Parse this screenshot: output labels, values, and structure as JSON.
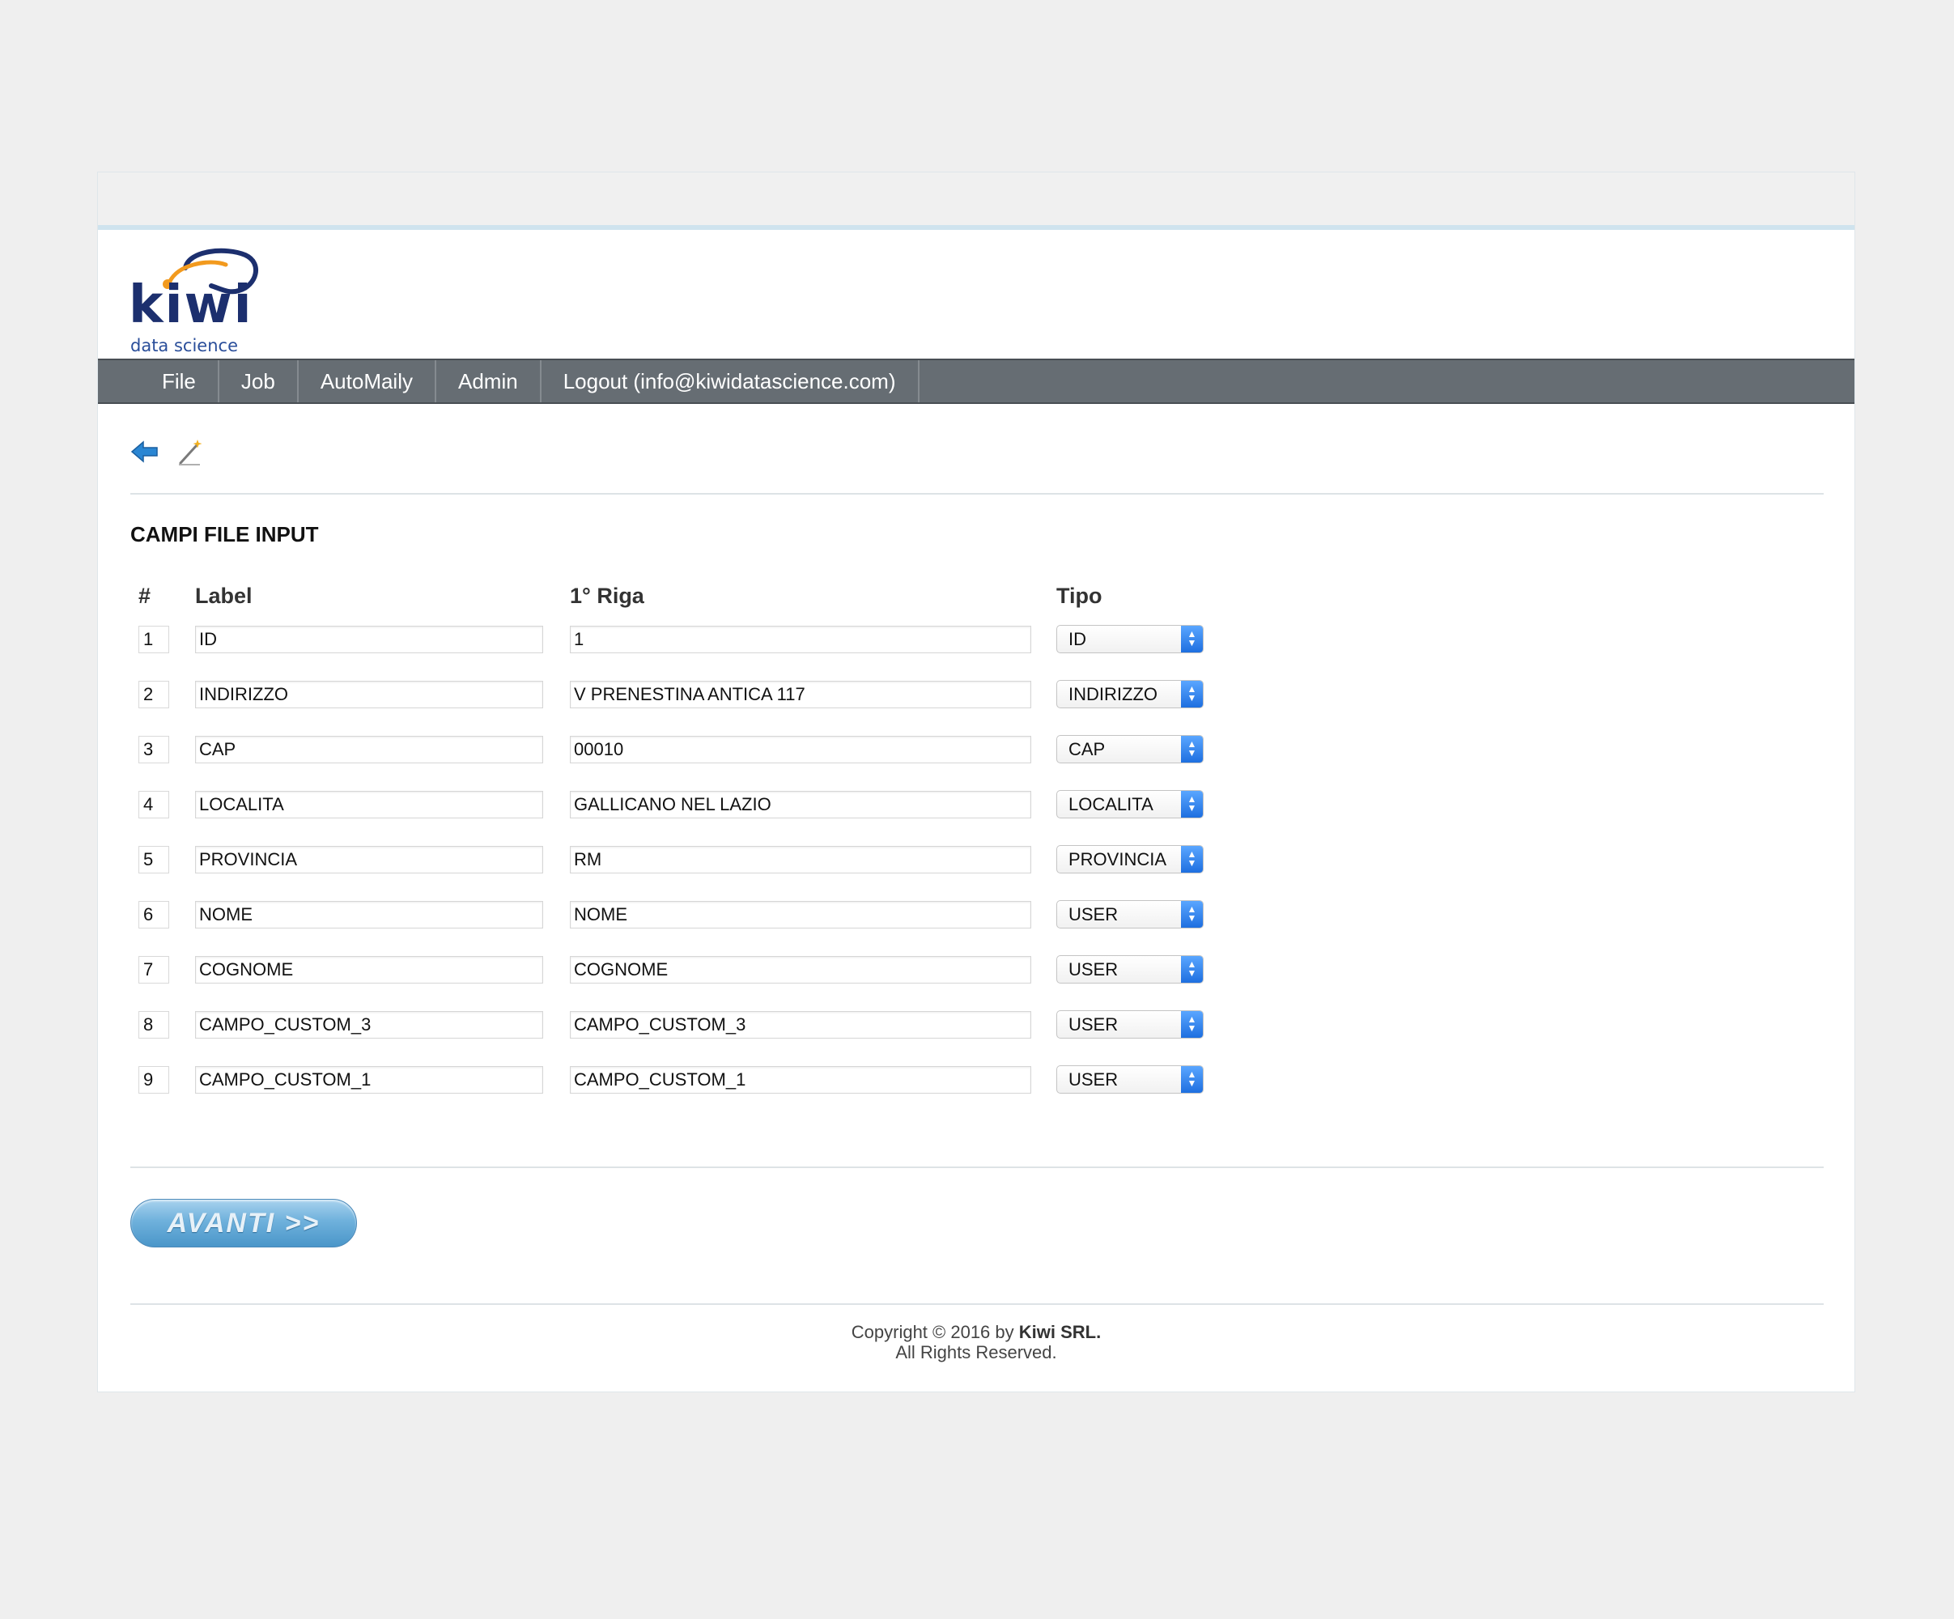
{
  "brand": {
    "logo_word": "kiwi",
    "logo_sub": "data science",
    "colors": {
      "navy": "#1c2f6e",
      "orange": "#f29a1e",
      "nav_bg": "#666d73",
      "select_accent": "#2f7ff0",
      "button_blue": "#6fb1dc"
    }
  },
  "nav": {
    "items": [
      {
        "label": "File"
      },
      {
        "label": "Job"
      },
      {
        "label": "AutoMaily"
      },
      {
        "label": "Admin"
      },
      {
        "label": "Logout (info@kiwidatascience.com)"
      }
    ]
  },
  "toolbar": {
    "icons": [
      "back-arrow-icon",
      "magic-wand-icon"
    ]
  },
  "section": {
    "title": "CAMPI FILE INPUT"
  },
  "table": {
    "headers": {
      "num": "#",
      "label": "Label",
      "riga": "1° Riga",
      "tipo": "Tipo"
    },
    "rows": [
      {
        "num": "1",
        "label": "ID",
        "riga": "1",
        "tipo": "ID"
      },
      {
        "num": "2",
        "label": "INDIRIZZO",
        "riga": "V PRENESTINA ANTICA 117",
        "tipo": "INDIRIZZO"
      },
      {
        "num": "3",
        "label": "CAP",
        "riga": "00010",
        "tipo": "CAP"
      },
      {
        "num": "4",
        "label": "LOCALITA",
        "riga": "GALLICANO NEL LAZIO",
        "tipo": "LOCALITA"
      },
      {
        "num": "5",
        "label": "PROVINCIA",
        "riga": "RM",
        "tipo": "PROVINCIA"
      },
      {
        "num": "6",
        "label": "NOME",
        "riga": "NOME",
        "tipo": "USER"
      },
      {
        "num": "7",
        "label": "COGNOME",
        "riga": "COGNOME",
        "tipo": "USER"
      },
      {
        "num": "8",
        "label": "CAMPO_CUSTOM_3",
        "riga": "CAMPO_CUSTOM_3",
        "tipo": "USER"
      },
      {
        "num": "9",
        "label": "CAMPO_CUSTOM_1",
        "riga": "CAMPO_CUSTOM_1",
        "tipo": "USER"
      }
    ]
  },
  "actions": {
    "next_label": "AVANTI >>"
  },
  "footer": {
    "copyright_prefix": "Copyright © 2016 by ",
    "company": "Kiwi SRL.",
    "rights": "All Rights Reserved."
  }
}
